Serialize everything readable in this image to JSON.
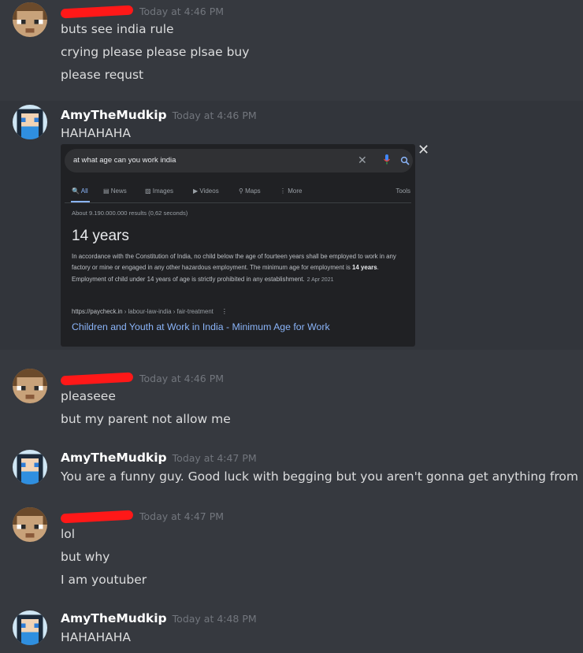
{
  "messages": [
    {
      "author_redacted": true,
      "timestamp": "Today at 4:46 PM",
      "lines": [
        "buts see india rule",
        "crying please please plsae buy",
        "please requst"
      ]
    },
    {
      "author": "AmyTheMudkip",
      "timestamp": "Today at 4:46 PM",
      "lines": [
        "HAHAHAHA"
      ]
    },
    {
      "author_redacted": true,
      "timestamp": "Today at 4:46 PM",
      "lines": [
        "pleaseee",
        "but my parent not allow me"
      ]
    },
    {
      "author": "AmyTheMudkip",
      "timestamp": "Today at 4:47 PM",
      "lines": [
        "You are a funny guy. Good luck with begging but you aren't gonna get anything from me"
      ]
    },
    {
      "author_redacted": true,
      "timestamp": "Today at 4:47 PM",
      "lines": [
        "lol",
        "but why",
        "I am youtuber"
      ]
    },
    {
      "author": "AmyTheMudkip",
      "timestamp": "Today at 4:48 PM",
      "lines": [
        "HAHAHAHA"
      ]
    }
  ],
  "embed": {
    "query": "at what age can you work india",
    "tabs": [
      "All",
      "News",
      "Images",
      "Videos",
      "Maps",
      "More"
    ],
    "tools_label": "Tools",
    "stats": "About 9.190.000.000 results (0,62 seconds)",
    "answer": "14 years",
    "snippet_pre": "In accordance with the Constitution of India, no child below the age of fourteen years shall be employed to work in any factory or mine or engaged in any other hazardous employment. The minimum age for employment is ",
    "snippet_bold": "14 years",
    "snippet_post": ". Employment of child under 14 years of age is strictly prohibited in any establishment.",
    "snippet_date": "2 Apr 2021",
    "cite_domain": "https://paycheck.in",
    "cite_path": " › labour-law-india › fair-treatment",
    "result_title": "Children and Youth at Work in India - Minimum Age for Work"
  },
  "icons": {
    "close": "close-icon",
    "clear": "clear-search-icon",
    "mic": "microphone-icon",
    "search": "search-icon"
  },
  "colors": {
    "background": "#36393f",
    "username": "#ffffff",
    "timestamp": "#72767d",
    "link": "#8ab4f8",
    "redaction": "#ff1818"
  }
}
